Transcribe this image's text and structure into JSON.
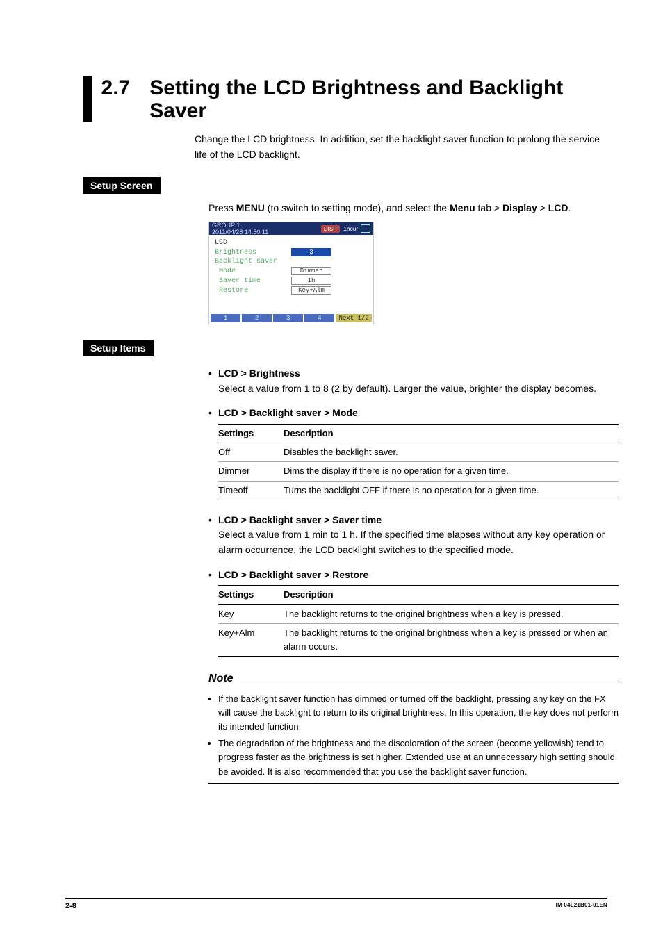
{
  "section": {
    "number": "2.7",
    "title": "Setting the LCD Brightness and Backlight Saver"
  },
  "intro": "Change the LCD brightness. In addition, set the backlight saver function to prolong the service life of the LCD backlight.",
  "setup_screen": {
    "heading": "Setup Screen",
    "instruction_pre": "Press ",
    "instruction_menu1": "MENU",
    "instruction_mid": " (to switch to setting mode), and select the ",
    "instruction_menu2": "Menu",
    "instruction_tab": " tab > ",
    "instruction_display": "Display",
    "instruction_gt": " > ",
    "instruction_lcd": "LCD",
    "instruction_end": "."
  },
  "screenshot": {
    "group": "GROUP 1",
    "datetime": "2011/04/28 14:50:11",
    "disp_badge": "DISP",
    "hour": "1hour",
    "panel_title": "LCD",
    "rows": {
      "brightness_label": "Brightness",
      "brightness_value": "3",
      "backlight_label": "Backlight saver",
      "mode_label": "Mode",
      "mode_value": "Dimmer",
      "saver_label": "Saver time",
      "saver_value": "1h",
      "restore_label": "Restore",
      "restore_value": "Key+Alm"
    },
    "footbtns": {
      "b1": "1",
      "b2": "2",
      "b3": "3",
      "b4": "4",
      "next": "Next 1/2"
    }
  },
  "setup_items": {
    "heading": "Setup Items",
    "brightness": {
      "title": "LCD > Brightness",
      "desc": "Select a value from 1 to 8 (2 by default). Larger the value, brighter the display becomes."
    },
    "mode": {
      "title": "LCD > Backlight saver > Mode",
      "th_settings": "Settings",
      "th_desc": "Description",
      "rows": [
        {
          "s": "Off",
          "d": "Disables the backlight saver."
        },
        {
          "s": "Dimmer",
          "d": "Dims the display if there is no operation for a given time."
        },
        {
          "s": "Timeoff",
          "d": "Turns the backlight OFF if there is no operation for a given time."
        }
      ]
    },
    "saver_time": {
      "title": "LCD > Backlight saver > Saver time",
      "desc": "Select a value from 1 min to 1 h. If the specified time elapses without any key operation or alarm occurrence, the LCD backlight switches to the specified mode."
    },
    "restore": {
      "title": "LCD > Backlight saver > Restore",
      "th_settings": "Settings",
      "th_desc": "Description",
      "rows": [
        {
          "s": "Key",
          "d": "The backlight returns to the original brightness when a key is pressed."
        },
        {
          "s": "Key+Alm",
          "d": "The backlight returns to the original brightness when a key is pressed or when an alarm occurs."
        }
      ]
    }
  },
  "note": {
    "heading": "Note",
    "items": [
      "If the backlight saver function has dimmed or turned off the backlight, pressing any key on the FX will cause the backlight to return to its original brightness. In this operation, the key does not perform its intended function.",
      "The degradation of the brightness and the discoloration of the screen (become yellowish) tend to progress faster as the brightness is set higher. Extended use at an unnecessary high setting should be avoided. It is also recommended that you use the backlight saver function."
    ]
  },
  "footer": {
    "page": "2-8",
    "docid": "IM 04L21B01-01EN"
  }
}
